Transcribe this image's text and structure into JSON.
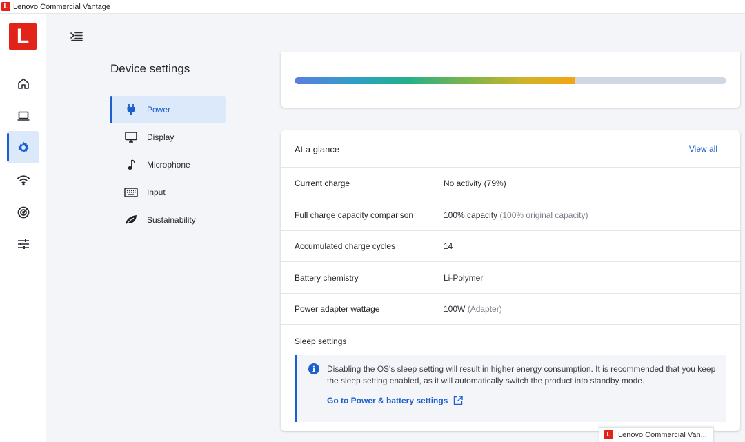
{
  "window": {
    "title": "Lenovo Commercial Vantage",
    "logo_letter": "L"
  },
  "rail": {
    "logo_letter": "L",
    "items": [
      {
        "name": "home",
        "icon": "home-icon"
      },
      {
        "name": "device",
        "icon": "laptop-icon"
      },
      {
        "name": "settings",
        "icon": "gear-icon",
        "active": true
      },
      {
        "name": "network",
        "icon": "wifi-icon"
      },
      {
        "name": "security",
        "icon": "shield-scan-icon"
      },
      {
        "name": "preferences",
        "icon": "sliders-icon"
      }
    ]
  },
  "section_title": "Device settings",
  "subnav": [
    {
      "label": "Power",
      "icon": "plug-icon",
      "active": true
    },
    {
      "label": "Display",
      "icon": "monitor-icon"
    },
    {
      "label": "Microphone",
      "icon": "music-note-icon"
    },
    {
      "label": "Input",
      "icon": "keyboard-icon"
    },
    {
      "label": "Sustainability",
      "icon": "leaf-icon"
    }
  ],
  "battery_bar": {
    "level": 0.65
  },
  "glance": {
    "title": "At a glance",
    "view_all": "View all",
    "rows": [
      {
        "label": "Current charge",
        "value": "No activity (79%)",
        "note": ""
      },
      {
        "label": "Full charge capacity comparison",
        "value": "100% capacity",
        "note": "(100% original capacity)"
      },
      {
        "label": "Accumulated charge cycles",
        "value": "14",
        "note": ""
      },
      {
        "label": "Battery chemistry",
        "value": "Li-Polymer",
        "note": ""
      },
      {
        "label": "Power adapter wattage",
        "value": "100W",
        "note": "(Adapter)"
      }
    ],
    "sleep_title": "Sleep settings",
    "notice_text": "Disabling the OS's sleep setting will result in higher energy consumption. It is recommended that you keep the sleep setting enabled, as it will automatically switch the product into standby mode.",
    "notice_link": "Go to Power & battery settings"
  },
  "task_chip": {
    "label": "Lenovo Commercial Van..."
  },
  "colors": {
    "accent": "#1c5fcf",
    "brand": "#e2231a",
    "active_bg": "#dce9fb"
  }
}
